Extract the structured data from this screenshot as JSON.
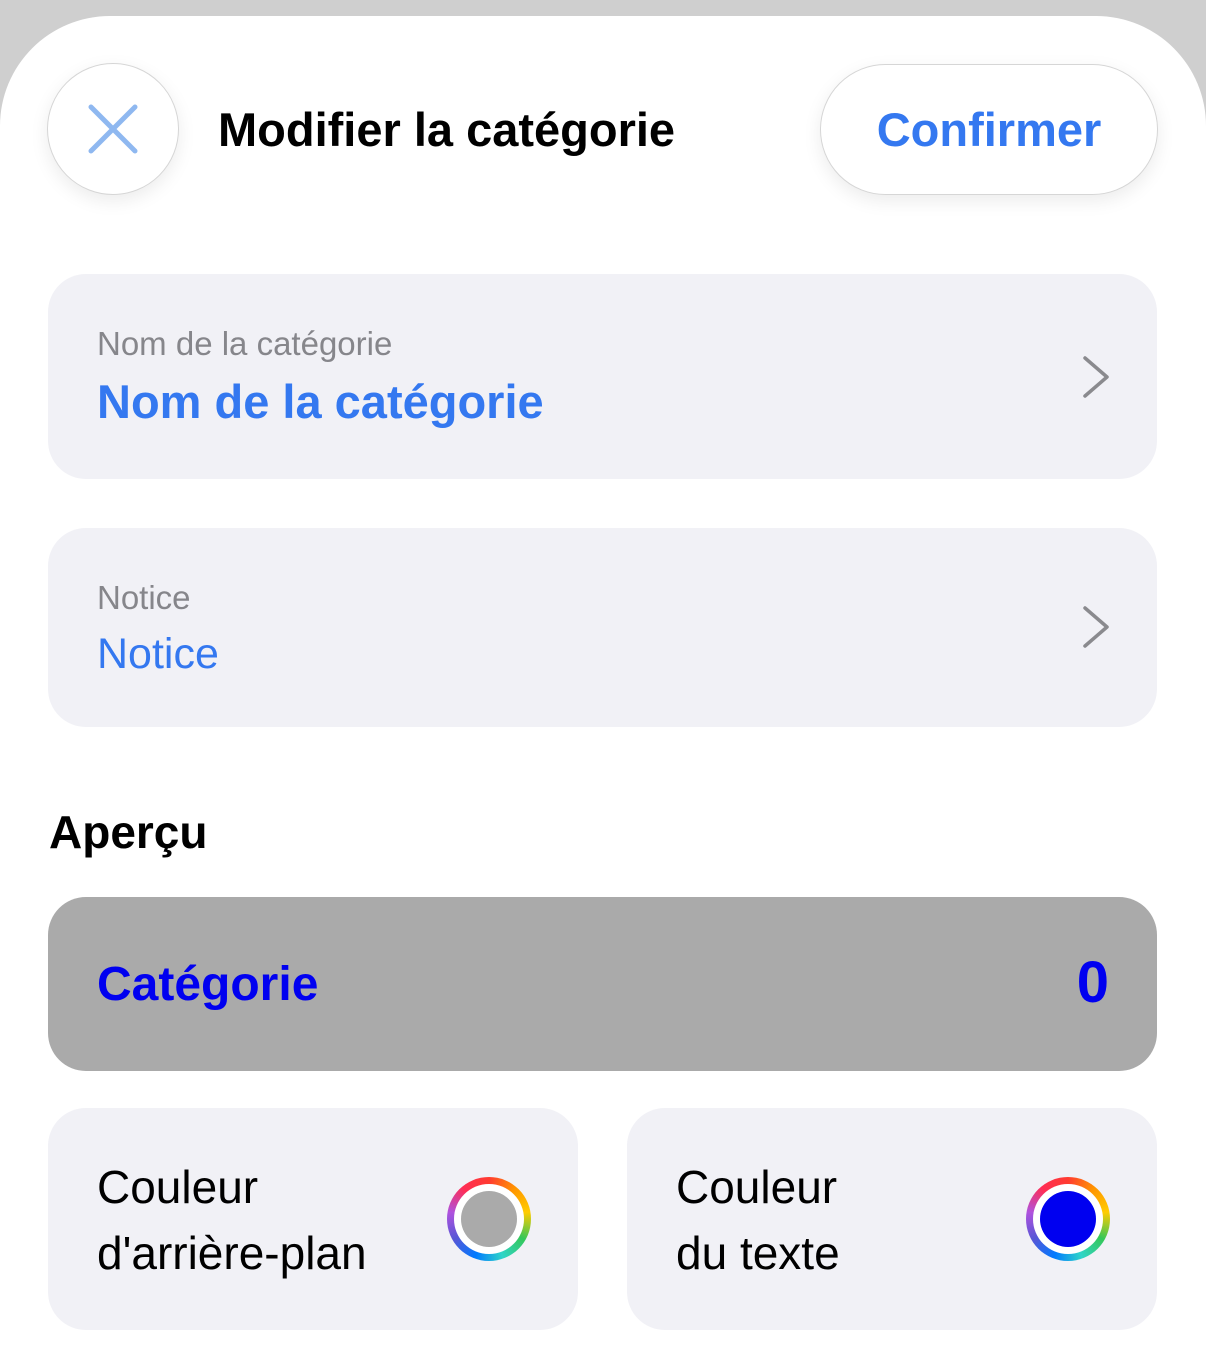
{
  "header": {
    "title": "Modifier la catégorie",
    "confirm_label": "Confirmer",
    "close_icon": "xmark-icon"
  },
  "fields": {
    "name": {
      "caption": "Nom de la catégorie",
      "value": "Nom de la catégorie"
    },
    "notice": {
      "caption": "Notice",
      "value": "Notice"
    }
  },
  "preview": {
    "section_title": "Aperçu",
    "label": "Catégorie",
    "count": "0",
    "background_color": "#aaaaaa",
    "text_color": "#0000f0"
  },
  "colors": {
    "background": {
      "label_line1": "Couleur",
      "label_line2": "d'arrière-plan",
      "swatch": "#aaaaaa"
    },
    "text": {
      "label_line1": "Couleur",
      "label_line2": "du texte",
      "swatch": "#0000f0"
    }
  },
  "theme": {
    "accent": "#3478f0",
    "card_bg": "#f1f1f6",
    "caption": "#86868b"
  }
}
